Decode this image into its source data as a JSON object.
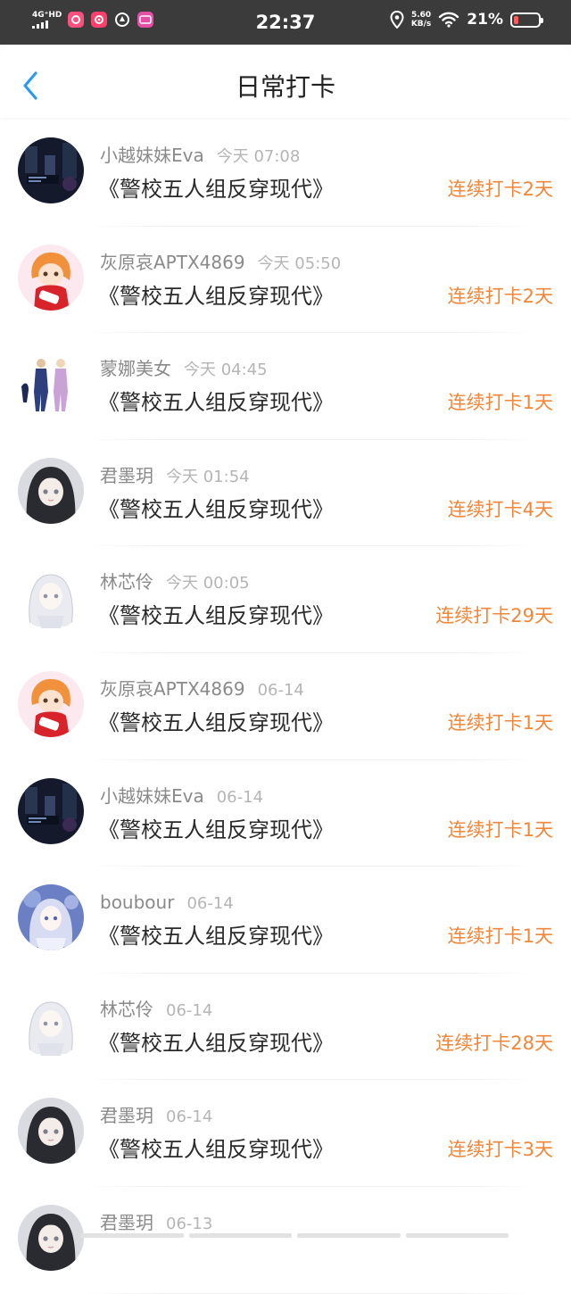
{
  "status_bar": {
    "network": "4G⁺HD",
    "time": "22:37",
    "speed_value": "5.60",
    "speed_unit": "KB/s",
    "battery_percent": "21%",
    "battery_level": 0.21,
    "icons": [
      "signal-icon",
      "app-icon-pink-1",
      "app-icon-pink-2",
      "app-icon-circle",
      "app-icon-purple",
      "location-icon",
      "wifi-icon",
      "battery-icon"
    ]
  },
  "nav": {
    "title": "日常打卡",
    "back_icon": "chevron-left-icon"
  },
  "colors": {
    "accent_orange": "#f0873a",
    "back_blue": "#2c9af0"
  },
  "checkins": [
    {
      "name": "小越妹妹Eva",
      "time": "今天 07:08",
      "book": "《警校五人组反穿现代》",
      "streak": "连续打卡2天",
      "avatar": "dark-room"
    },
    {
      "name": "灰原哀APTX4869",
      "time": "今天 05:50",
      "book": "《警校五人组反穿现代》",
      "streak": "连续打卡2天",
      "avatar": "red-girl"
    },
    {
      "name": "蒙娜美女",
      "time": "今天 04:45",
      "book": "《警校五人组反穿现代》",
      "streak": "连续打卡1天",
      "avatar": "two-figures"
    },
    {
      "name": "君墨玥",
      "time": "今天 01:54",
      "book": "《警校五人组反穿现代》",
      "streak": "连续打卡4天",
      "avatar": "dark-hair-girl"
    },
    {
      "name": "林芯伶",
      "time": "今天 00:05",
      "book": "《警校五人组反穿现代》",
      "streak": "连续打卡29天",
      "avatar": "white-hair-girl"
    },
    {
      "name": "灰原哀APTX4869",
      "time": "06-14",
      "book": "《警校五人组反穿现代》",
      "streak": "连续打卡1天",
      "avatar": "red-girl"
    },
    {
      "name": "小越妹妹Eva",
      "time": "06-14",
      "book": "《警校五人组反穿现代》",
      "streak": "连续打卡1天",
      "avatar": "dark-room"
    },
    {
      "name": "boubour",
      "time": "06-14",
      "book": "《警校五人组反穿现代》",
      "streak": "连续打卡1天",
      "avatar": "blue-girl"
    },
    {
      "name": "林芯伶",
      "time": "06-14",
      "book": "《警校五人组反穿现代》",
      "streak": "连续打卡28天",
      "avatar": "white-hair-girl"
    },
    {
      "name": "君墨玥",
      "time": "06-14",
      "book": "《警校五人组反穿现代》",
      "streak": "连续打卡3天",
      "avatar": "dark-hair-girl"
    },
    {
      "name": "君墨玥",
      "time": "06-13",
      "book": "",
      "streak": "",
      "avatar": "dark-hair-girl"
    }
  ]
}
